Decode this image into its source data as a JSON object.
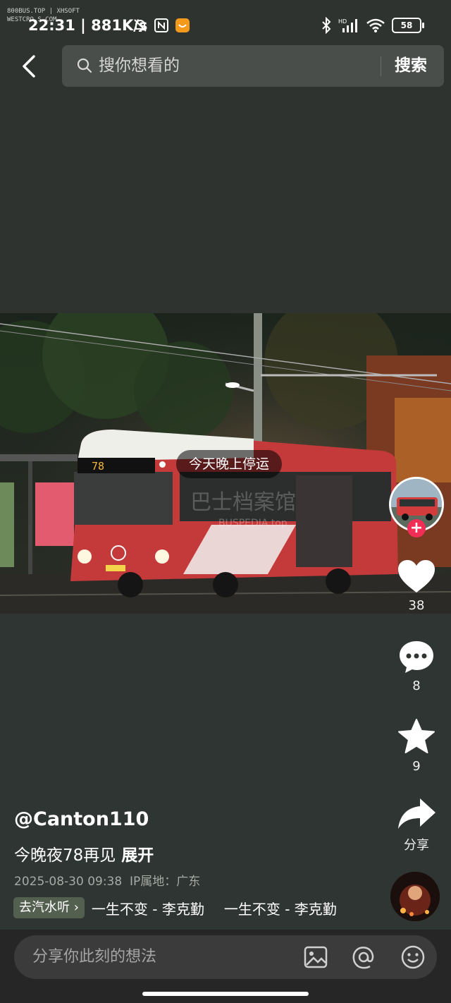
{
  "watermark": {
    "line1": "800BUS.TOP | XHSOFT",
    "line2": "WESTCRO.S.COM"
  },
  "status_bar": {
    "time": "22:31",
    "speed": "881K/s",
    "battery": "58",
    "network": "HD"
  },
  "search": {
    "placeholder": "搜你想看的",
    "button_label": "搜索"
  },
  "photo": {
    "tag_label": "今天晚上停运",
    "route_sign": "78",
    "watermark_cn": "巴士档案馆",
    "watermark_en": "BUSPEDIA.top"
  },
  "actions": {
    "like_count": "38",
    "comment_count": "8",
    "favorite_count": "9",
    "share_label": "分享"
  },
  "post": {
    "author": "@Canton110",
    "caption": "今晚夜78再见",
    "expand_label": "展开",
    "datetime": "2025-08-30 09:38",
    "ip_location": "IP属地：广东",
    "music_tag": "去汽水听",
    "music_title": "一生不变 - 李克勤",
    "music_title_repeat": "一生不变 - 李克勤"
  },
  "comment_bar": {
    "placeholder": "分享你此刻的想法"
  },
  "colors": {
    "follow": "#f22d56",
    "background": "#2f3430"
  }
}
